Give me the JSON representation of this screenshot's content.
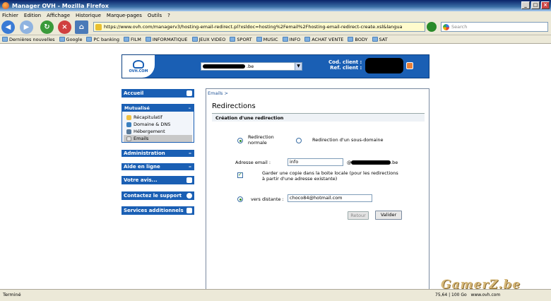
{
  "window": {
    "title": "Manager OVH - Mozilla Firefox",
    "min": "_",
    "max": "□",
    "close": "×"
  },
  "menu": [
    "Fichier",
    "Edition",
    "Affichage",
    "Historique",
    "Marque-pages",
    "Outils",
    "?"
  ],
  "nav": {
    "url": "https://www.ovh.com/managerv3/hosting-email-redirect.pl?xsldoc=hosting%2Femail%2Fhosting-email-redirect-create.xsl&langua",
    "search_placeholder": "Search"
  },
  "bookmarks": [
    "Dernières nouvelles",
    "Google",
    "PC banking",
    "FILM",
    "INFORMATIQUE",
    "JEUX VIDEO",
    "SPORT",
    "MUSIC",
    "INFO",
    "ACHAT VENTE",
    "BODY",
    "SAT"
  ],
  "header": {
    "logo_text": "OVH.COM",
    "domain_suffix": ".be",
    "cod_client_label": "Cod. client :",
    "ref_client_label": "Ref. client :"
  },
  "sidebar": {
    "accueil": "Accueil",
    "mutualise": "Mutualisé",
    "sub_items": [
      "Récapitulatif",
      "Domaine & DNS",
      "Hébergement",
      "Emails"
    ],
    "administration": "Administration",
    "aide": "Aide en ligne",
    "votre_avis": "Votre avis...",
    "contact": "Contactez le support",
    "services": "Services additionnels",
    "minus": "–"
  },
  "main": {
    "breadcrumb": "Emails >",
    "title": "Redirections",
    "section": "Création d'une redirection",
    "radio_normal_line1": "Redirection",
    "radio_normal_line2": "normale",
    "radio_sub": "Redirection d'un sous-domaine",
    "email_label": "Adresse email :",
    "email_value": "info",
    "at_sign": "@",
    "domain_suffix": ".be",
    "copy_line1": "Garder une copie dans la boite locale (pour les redirections",
    "copy_line2": "à partir d'une adresse existante)",
    "dest_label": "vers distante :",
    "dest_value": "choco84@hotmail.com",
    "retour": "Retour",
    "valider": "Valider"
  },
  "status": {
    "text": "Terminé",
    "zoom": "75,64 | 100 Go",
    "host": "www.ovh.com"
  },
  "watermark": "GamerZ.be"
}
